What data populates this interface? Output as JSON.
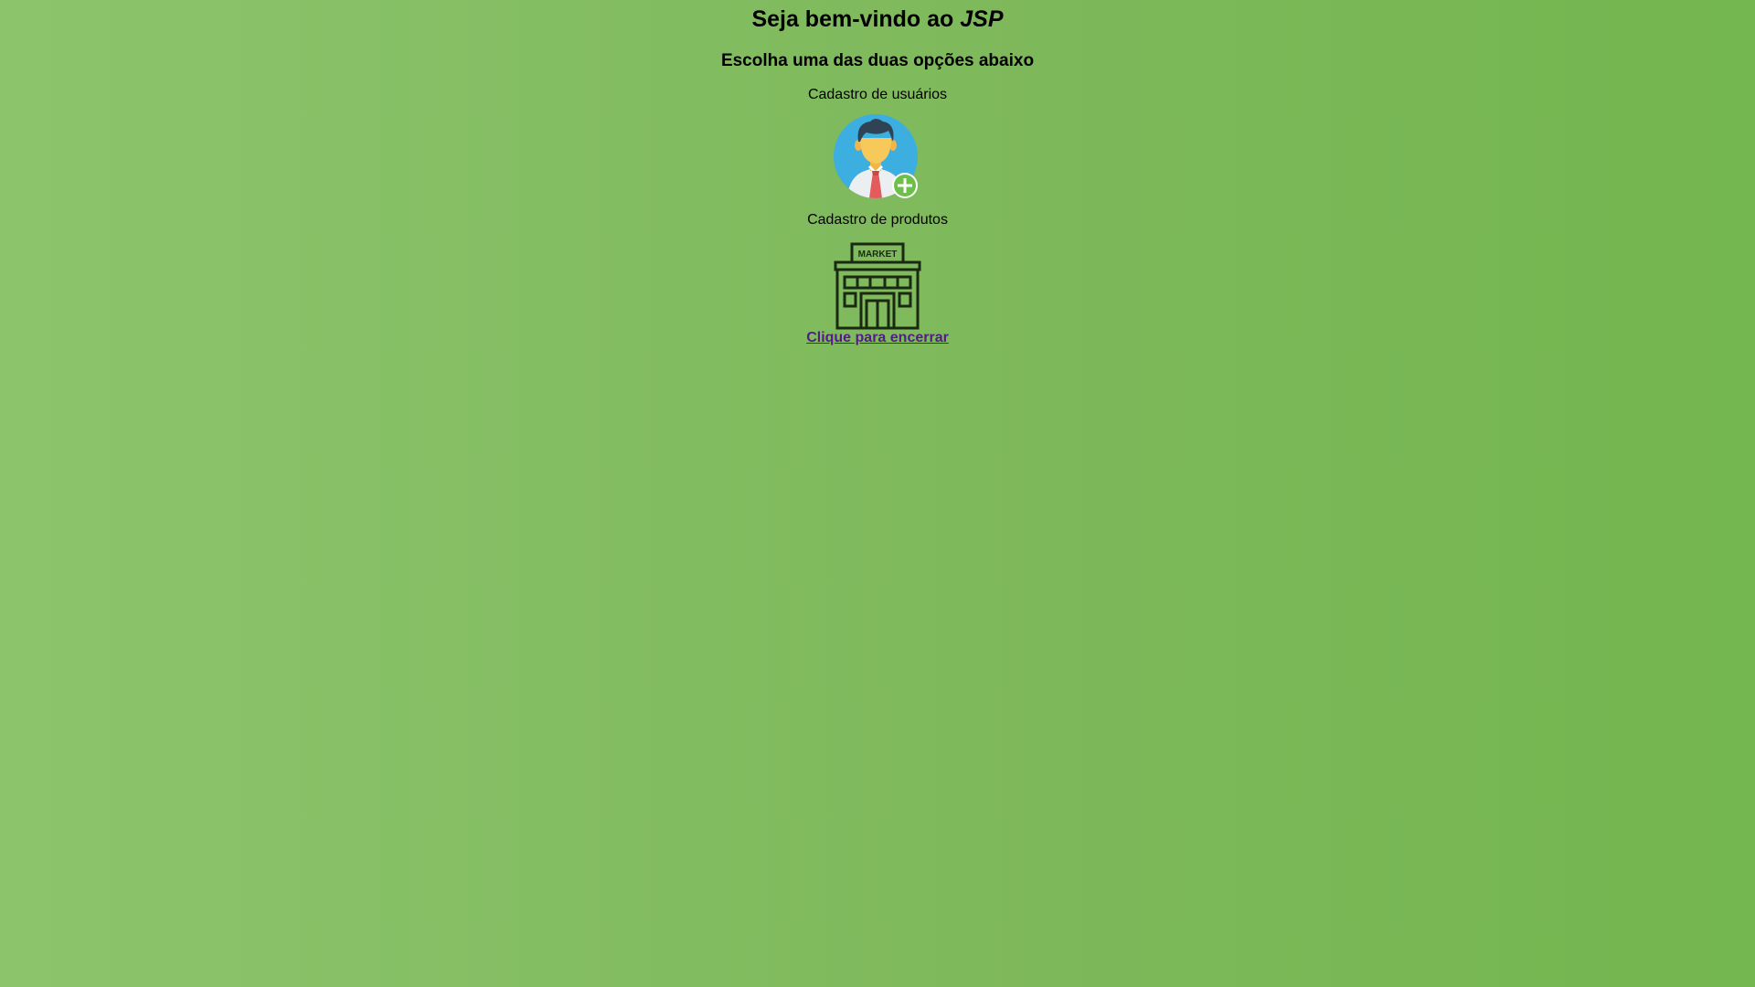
{
  "header": {
    "title_prefix": "Seja bem-vindo ao ",
    "title_emphasis": "JSP",
    "subtitle": "Escolha uma das duas opções abaixo"
  },
  "options": [
    {
      "label": "Cadastro de usuários",
      "icon": "user-add-icon"
    },
    {
      "label": "Cadastro de produtos",
      "icon": "market-store-icon",
      "sign_text": "MARKET"
    }
  ],
  "logout": {
    "label": "Clique para encerrar"
  },
  "colors": {
    "background_start": "#8cc46c",
    "background_end": "#74b64f",
    "link": "#551a8b",
    "user_circle": "#3daee0",
    "plus_badge": "#6cc04a",
    "tie": "#e45b5b"
  }
}
